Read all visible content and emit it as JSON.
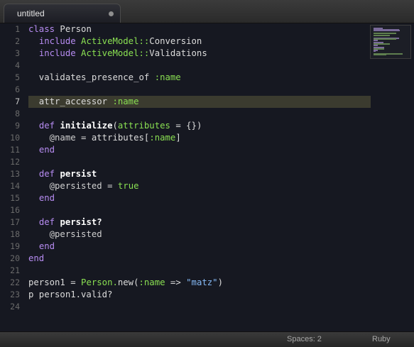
{
  "tab": {
    "title": "untitled"
  },
  "status": {
    "spaces": "Spaces: 2",
    "syntax": "Ruby"
  },
  "active_line": 7,
  "colors": {
    "background": "#161821",
    "keyword": "#b78cf2",
    "constant": "#8ae052",
    "string": "#85b9f5",
    "active_line": "#3b3b2f"
  },
  "lines": [
    [
      [
        "keyword",
        "class"
      ],
      [
        "plain",
        " Person"
      ]
    ],
    [
      [
        "plain",
        "  "
      ],
      [
        "keyword",
        "include"
      ],
      [
        "plain",
        " "
      ],
      [
        "const",
        "ActiveModel"
      ],
      [
        "punct",
        "::"
      ],
      [
        "plain",
        "Conversion"
      ]
    ],
    [
      [
        "plain",
        "  "
      ],
      [
        "keyword",
        "include"
      ],
      [
        "plain",
        " "
      ],
      [
        "const",
        "ActiveModel"
      ],
      [
        "punct",
        "::"
      ],
      [
        "plain",
        "Validations"
      ]
    ],
    [],
    [
      [
        "plain",
        "  validates_presence_of "
      ],
      [
        "symbol",
        ":name"
      ]
    ],
    [],
    [
      [
        "plain",
        "  attr_accessor "
      ],
      [
        "symbol",
        ":name"
      ]
    ],
    [],
    [
      [
        "plain",
        "  "
      ],
      [
        "keyword",
        "def"
      ],
      [
        "plain",
        " "
      ],
      [
        "fn",
        "initialize"
      ],
      [
        "plain",
        "("
      ],
      [
        "symbol",
        "attributes"
      ],
      [
        "plain",
        " = {})"
      ]
    ],
    [
      [
        "plain",
        "    "
      ],
      [
        "ivar",
        "@name"
      ],
      [
        "plain",
        " = attributes["
      ],
      [
        "symbol",
        ":name"
      ],
      [
        "plain",
        "]"
      ]
    ],
    [
      [
        "plain",
        "  "
      ],
      [
        "keyword",
        "end"
      ]
    ],
    [],
    [
      [
        "plain",
        "  "
      ],
      [
        "keyword",
        "def"
      ],
      [
        "plain",
        " "
      ],
      [
        "fn",
        "persist"
      ]
    ],
    [
      [
        "plain",
        "    "
      ],
      [
        "ivar",
        "@persisted"
      ],
      [
        "plain",
        " = "
      ],
      [
        "const",
        "true"
      ]
    ],
    [
      [
        "plain",
        "  "
      ],
      [
        "keyword",
        "end"
      ]
    ],
    [],
    [
      [
        "plain",
        "  "
      ],
      [
        "keyword",
        "def"
      ],
      [
        "plain",
        " "
      ],
      [
        "fn",
        "persist?"
      ]
    ],
    [
      [
        "plain",
        "    "
      ],
      [
        "ivar",
        "@persisted"
      ]
    ],
    [
      [
        "plain",
        "  "
      ],
      [
        "keyword",
        "end"
      ]
    ],
    [
      [
        "keyword",
        "end"
      ]
    ],
    [],
    [
      [
        "plain",
        "person1 = "
      ],
      [
        "const",
        "Person"
      ],
      [
        "punct",
        "."
      ],
      [
        "method",
        "new"
      ],
      [
        "plain",
        "("
      ],
      [
        "symbol",
        ":name"
      ],
      [
        "plain",
        " => "
      ],
      [
        "string",
        "\"matz\""
      ],
      [
        "plain",
        ")"
      ]
    ],
    [
      [
        "plain",
        "p person1.valid?"
      ]
    ],
    []
  ]
}
